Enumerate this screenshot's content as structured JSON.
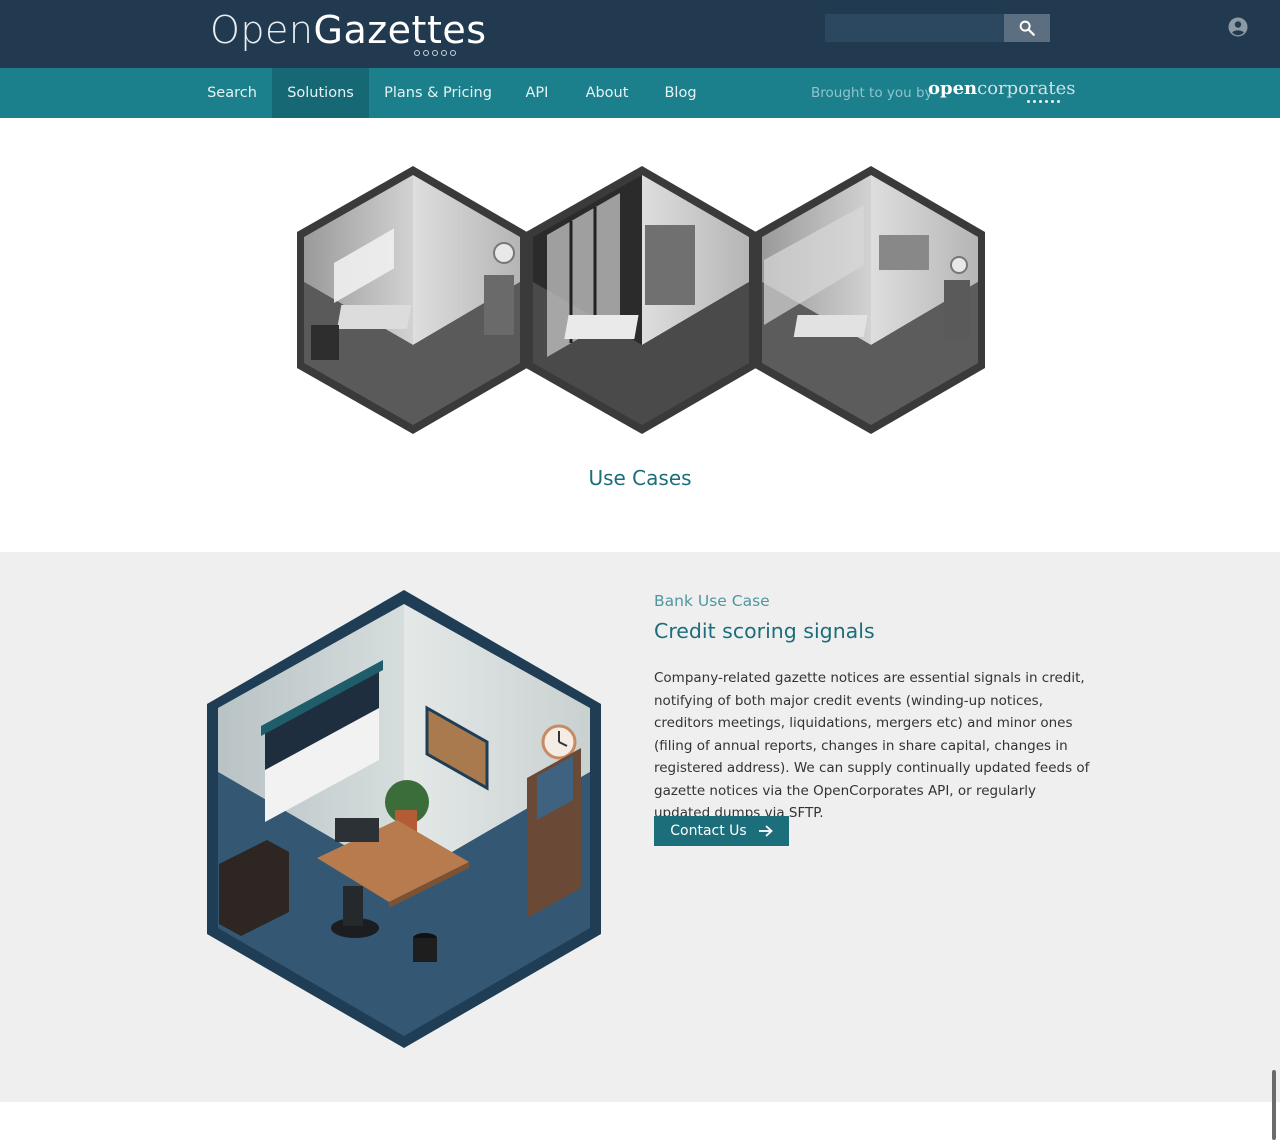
{
  "header": {
    "logo_prefix": "Open",
    "logo_suffix": "Gazettes",
    "search_placeholder": "",
    "search_icon": "search-icon",
    "user_icon": "user-account-icon"
  },
  "nav": {
    "items": [
      {
        "label": "Search"
      },
      {
        "label": "Solutions"
      },
      {
        "label": "Plans & Pricing"
      },
      {
        "label": "API"
      },
      {
        "label": "About"
      },
      {
        "label": "Blog"
      }
    ],
    "active": "Solutions",
    "brought_by": "Brought to you by",
    "partner_logo_a": "open",
    "partner_logo_b": "corporates"
  },
  "hero": {
    "heading": "Use Cases"
  },
  "feature": {
    "eyebrow": "Bank Use Case",
    "title": "Credit scoring signals",
    "body": "Company-related gazette notices are essential signals in credit, notifying of both major credit events (winding-up notices, creditors meetings, liquidations, mergers etc) and minor ones (filing of annual reports, changes in share capital, changes in registered address). We can supply continually updated feeds of gazette notices via the OpenCorporates API, or regularly updated dumps via SFTP.",
    "cta_label": "Contact Us",
    "cta_icon": "arrow-right-icon"
  },
  "colors": {
    "header_bg": "#223a4f",
    "nav_bg": "#1b7f8c",
    "nav_active": "#156874",
    "accent": "#1b6e7a",
    "section_bg": "#efefef"
  }
}
